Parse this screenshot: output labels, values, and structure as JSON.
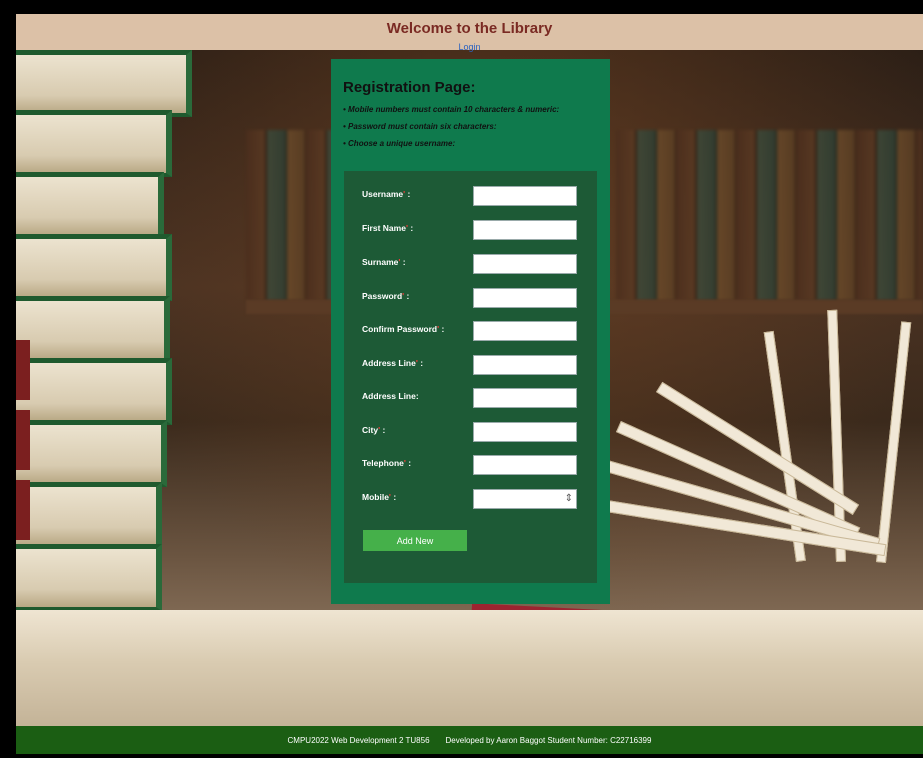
{
  "header": {
    "title": "Welcome to the Library",
    "login_link": "Login"
  },
  "registration": {
    "title": "Registration Page:",
    "rules": [
      "• Mobile numbers must contain 10 characters & numeric:",
      "• Password must contain six characters:",
      "• Choose a unique username:"
    ],
    "fields": [
      {
        "label": "Username",
        "required": true,
        "value": ""
      },
      {
        "label": "First Name",
        "required": true,
        "value": ""
      },
      {
        "label": "Surname",
        "required": true,
        "value": ""
      },
      {
        "label": "Password",
        "required": true,
        "value": ""
      },
      {
        "label": "Confirm Password",
        "required": true,
        "value": ""
      },
      {
        "label": "Address Line",
        "required": true,
        "value": ""
      },
      {
        "label": "Address Line:",
        "required": false,
        "value": ""
      },
      {
        "label": "City",
        "required": true,
        "value": ""
      },
      {
        "label": "Telephone",
        "required": true,
        "value": ""
      },
      {
        "label": "Mobile",
        "required": true,
        "value": ""
      }
    ],
    "submit_label": "Add New"
  },
  "footer": {
    "course": "CMPU2022 Web Development 2 TU856",
    "developer": "Developed by Aaron Baggot Student Number: C22716399"
  },
  "colors": {
    "header_bg": "#dcc1a7",
    "title_color": "#7a2a23",
    "panel_bg": "#0f7a4d",
    "form_bg": "#1d5a36",
    "button_bg": "#45b04a",
    "footer_bg": "#1b5e13",
    "required_marker": "#ff3b3b"
  }
}
